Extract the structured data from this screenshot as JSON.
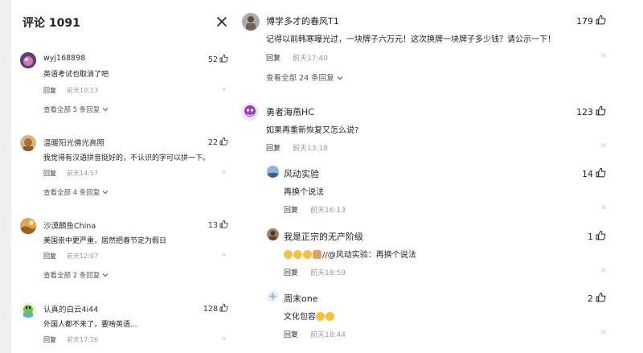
{
  "left_panel": {
    "title": "评论 1091",
    "comments": [
      {
        "user": "wyj168898",
        "likes": "52",
        "text": "英语考试也取消了吧",
        "reply": "回复",
        "time": "前天10:13",
        "more": "查看全部 5 条回复",
        "avatar_color": "#8a5a8c"
      },
      {
        "user": "温暖阳光佛光高照",
        "likes": "22",
        "text": "我觉得有汉语拼音挺好的，不认识的字可以拼一下。",
        "reply": "回复",
        "time": "前天14:57",
        "more": "查看全部 4 条回复",
        "avatar_color": "#c9a06a"
      },
      {
        "user": "沙漠麟鱼China",
        "likes": "13",
        "text": "美国崇中更严重，居然把春节定为假日",
        "reply": "回复",
        "time": "前天12:07",
        "more": "查看全部 2 条回复",
        "avatar_color": "#c4862f"
      },
      {
        "user": "认真的白云4i44",
        "likes": "128",
        "text": "外国人都不来了，要啥英语...",
        "reply": "回复",
        "time": "前天17:26",
        "more": "",
        "avatar_color": "#4fb1d9"
      }
    ],
    "close_icon": "close-icon"
  },
  "right_panel": {
    "comments": [
      {
        "user": "博学多才的春风T1",
        "likes": "179",
        "text": "记得以前韩寒曝光过，一块牌子六万元！这次换牌一块牌子多少钱？请公示一下！",
        "reply": "回复",
        "time": "前天17:40",
        "more": "查看全部 24 条回复",
        "avatar_color": "#9a8f88"
      },
      {
        "user": "勇者海燕HC",
        "likes": "123",
        "text": "如果再重新恢复又怎么说?",
        "reply": "回复",
        "time": "前天13:18",
        "more": "",
        "avatar_color": "#9a3fbf"
      }
    ],
    "replies": [
      {
        "user": "风动实验",
        "likes": "14",
        "text": "再换个说法",
        "reply": "回复",
        "time": "前天16:13",
        "avatar_color": "#5a7fa6"
      },
      {
        "user": "我是正宗的无产阶级",
        "likes": "1",
        "text_suffix": "//@风动实验：再换个说法",
        "reply": "回复",
        "time": "前天18:59",
        "avatar_color": "#7a5a4a"
      },
      {
        "user": "周末one",
        "likes": "2",
        "text": "文化包容",
        "reply": "回复",
        "time": "前天18:44",
        "avatar_color": "#d8e6f0"
      }
    ]
  },
  "icons": {
    "thumb": "thumb-up-icon",
    "chevron": "chevron-down-icon",
    "dismiss": "dismiss-x-icon"
  },
  "dismiss_glyph": "✕"
}
